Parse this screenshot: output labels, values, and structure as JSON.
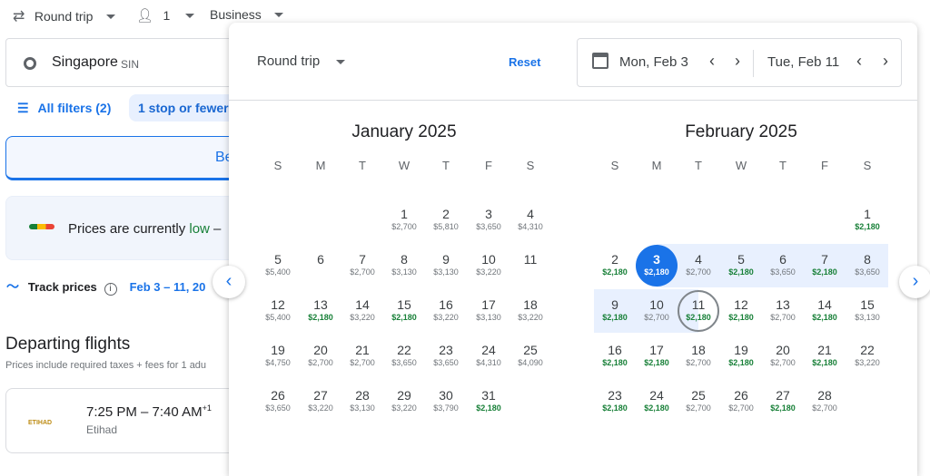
{
  "topbar": {
    "trip_type": "Round trip",
    "passengers": "1",
    "cabin": "Business"
  },
  "origin": {
    "city": "Singapore",
    "code": "SIN"
  },
  "filters": {
    "all_filters": "All filters (2)",
    "stops_chip": "1 stop or fewer"
  },
  "tabs": {
    "best_partial": "Be"
  },
  "insight": {
    "text_prefix": "Prices are currently ",
    "level": "low",
    "text_suffix": " –"
  },
  "track": {
    "label": "Track prices",
    "dates": "Feb 3 – 11, 20"
  },
  "departing": {
    "title": "Departing flights",
    "subtitle": "Prices include required taxes + fees for 1 adu"
  },
  "flight": {
    "times": "7:25 PM – 7:40 AM",
    "day_offset": "+1",
    "airline": "Etihad",
    "logo_text": "ETIHAD"
  },
  "dialog": {
    "trip_type": "Round trip",
    "reset": "Reset",
    "depart_date": "Mon, Feb 3",
    "return_date": "Tue, Feb 11",
    "weekdays": [
      "S",
      "M",
      "T",
      "W",
      "T",
      "F",
      "S"
    ],
    "colors": {
      "accent": "#1a73e8",
      "low_price": "#188038",
      "range": "#e8f0fe"
    },
    "months": [
      {
        "title": "January 2025",
        "offset": 3,
        "days": [
          {
            "d": "1",
            "p": "$2,700"
          },
          {
            "d": "2",
            "p": "$5,810"
          },
          {
            "d": "3",
            "p": "$3,650"
          },
          {
            "d": "4",
            "p": "$4,310"
          },
          {
            "d": "5",
            "p": "$5,400"
          },
          {
            "d": "6",
            "p": ""
          },
          {
            "d": "7",
            "p": "$2,700"
          },
          {
            "d": "8",
            "p": "$3,130"
          },
          {
            "d": "9",
            "p": "$3,130"
          },
          {
            "d": "10",
            "p": "$3,220"
          },
          {
            "d": "11",
            "p": ""
          },
          {
            "d": "12",
            "p": "$5,400"
          },
          {
            "d": "13",
            "p": "$2,180",
            "low": true
          },
          {
            "d": "14",
            "p": "$3,220"
          },
          {
            "d": "15",
            "p": "$2,180",
            "low": true
          },
          {
            "d": "16",
            "p": "$3,220"
          },
          {
            "d": "17",
            "p": "$3,130"
          },
          {
            "d": "18",
            "p": "$3,220"
          },
          {
            "d": "19",
            "p": "$4,750"
          },
          {
            "d": "20",
            "p": "$2,700"
          },
          {
            "d": "21",
            "p": "$2,700"
          },
          {
            "d": "22",
            "p": "$3,650"
          },
          {
            "d": "23",
            "p": "$3,650"
          },
          {
            "d": "24",
            "p": "$4,310"
          },
          {
            "d": "25",
            "p": "$4,090"
          },
          {
            "d": "26",
            "p": "$3,650"
          },
          {
            "d": "27",
            "p": "$3,220"
          },
          {
            "d": "28",
            "p": "$3,130"
          },
          {
            "d": "29",
            "p": "$3,220"
          },
          {
            "d": "30",
            "p": "$3,790"
          },
          {
            "d": "31",
            "p": "$2,180",
            "low": true
          }
        ]
      },
      {
        "title": "February 2025",
        "offset": 6,
        "days": [
          {
            "d": "1",
            "p": "$2,180",
            "low": true
          },
          {
            "d": "2",
            "p": "$2,180",
            "low": true
          },
          {
            "d": "3",
            "p": "$2,180",
            "low": true,
            "state": "start"
          },
          {
            "d": "4",
            "p": "$2,700",
            "state": "range"
          },
          {
            "d": "5",
            "p": "$2,180",
            "low": true,
            "state": "range"
          },
          {
            "d": "6",
            "p": "$3,650",
            "state": "range"
          },
          {
            "d": "7",
            "p": "$2,180",
            "low": true,
            "state": "range"
          },
          {
            "d": "8",
            "p": "$3,650",
            "state": "range"
          },
          {
            "d": "9",
            "p": "$2,180",
            "low": true,
            "state": "range"
          },
          {
            "d": "10",
            "p": "$2,700",
            "state": "range"
          },
          {
            "d": "11",
            "p": "$2,180",
            "low": true,
            "state": "end"
          },
          {
            "d": "12",
            "p": "$2,180",
            "low": true
          },
          {
            "d": "13",
            "p": "$2,700"
          },
          {
            "d": "14",
            "p": "$2,180",
            "low": true
          },
          {
            "d": "15",
            "p": "$3,130"
          },
          {
            "d": "16",
            "p": "$2,180",
            "low": true
          },
          {
            "d": "17",
            "p": "$2,180",
            "low": true
          },
          {
            "d": "18",
            "p": "$2,700"
          },
          {
            "d": "19",
            "p": "$2,180",
            "low": true
          },
          {
            "d": "20",
            "p": "$2,700"
          },
          {
            "d": "21",
            "p": "$2,180",
            "low": true
          },
          {
            "d": "22",
            "p": "$3,220"
          },
          {
            "d": "23",
            "p": "$2,180",
            "low": true
          },
          {
            "d": "24",
            "p": "$2,180",
            "low": true
          },
          {
            "d": "25",
            "p": "$2,700"
          },
          {
            "d": "26",
            "p": "$2,700"
          },
          {
            "d": "27",
            "p": "$2,180",
            "low": true
          },
          {
            "d": "28",
            "p": "$2,700"
          }
        ]
      }
    ]
  }
}
